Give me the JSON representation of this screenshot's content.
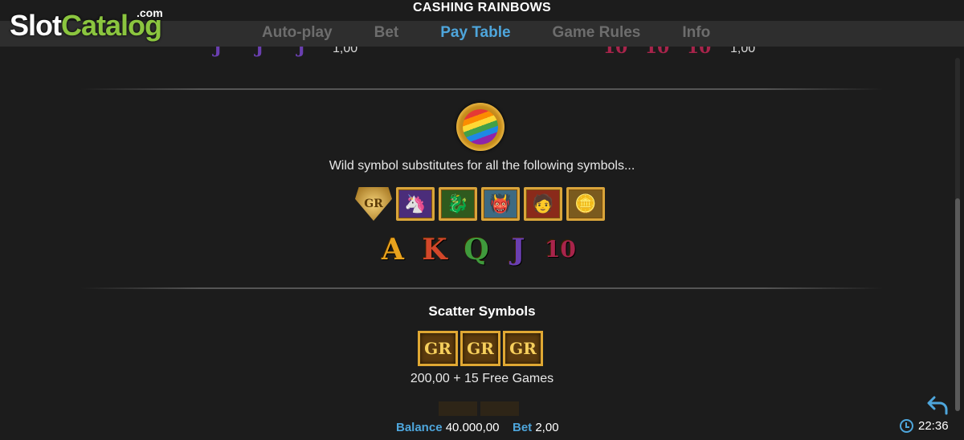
{
  "header": {
    "title": "CASHING RAINBOWS",
    "tabs": [
      {
        "label": "Auto-play",
        "active": false
      },
      {
        "label": "Bet",
        "active": false
      },
      {
        "label": "Pay Table",
        "active": true
      },
      {
        "label": "Game Rules",
        "active": false
      },
      {
        "label": "Info",
        "active": false
      }
    ]
  },
  "logo": {
    "part1": "Slot",
    "part2": "Catalog",
    "suffix": ".com"
  },
  "paytable": {
    "partial_left": {
      "symbol": "J",
      "value": "1,00"
    },
    "partial_right": {
      "symbol": "10",
      "value": "1,00"
    },
    "wild": {
      "icon": "rainbow-wild-icon",
      "description": "Wild symbol substitutes for all the following symbols..."
    },
    "substituted_symbols": [
      {
        "icon": "shield-gr-icon",
        "text": "GR"
      },
      {
        "icon": "unicorn-icon",
        "text": "🦄"
      },
      {
        "icon": "dragon-icon",
        "text": "🐉"
      },
      {
        "icon": "troll-icon",
        "text": "👹"
      },
      {
        "icon": "leprechaun-icon",
        "text": "🧑"
      },
      {
        "icon": "gold-coin-icon",
        "text": "🪙"
      }
    ],
    "letters": [
      {
        "text": "A",
        "color": "#e8a21d"
      },
      {
        "text": "K",
        "color": "#d2472a"
      },
      {
        "text": "Q",
        "color": "#3f9a3c"
      },
      {
        "text": "J",
        "color": "#6a3fb0"
      },
      {
        "text": "10",
        "color": "#a8244b"
      }
    ],
    "scatter": {
      "title": "Scatter Symbols",
      "symbol_text": "GR",
      "count": 3,
      "payout": "200,00 + 15 Free Games"
    }
  },
  "footer": {
    "balance_label": "Balance",
    "balance_value": "40.000,00",
    "bet_label": "Bet",
    "bet_value": "2,00",
    "time": "22:36"
  },
  "colors": {
    "accent": "#4ea6dc",
    "gold": "#d9a43a",
    "logo_green": "#8bc53f"
  }
}
